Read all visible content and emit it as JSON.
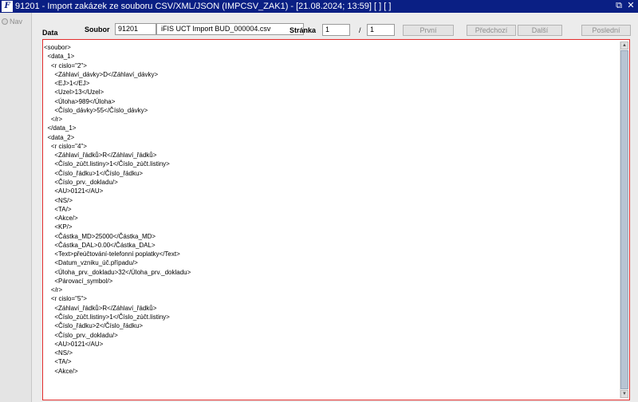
{
  "window": {
    "app_icon_text": "F",
    "title": "91201 - Import zakázek ze souboru CSV/XML/JSON (IMPCSV_ZAK1) - [21.08.2024; 13:59]  [ ]  [ ]",
    "restore_glyph": "⧉",
    "close_glyph": "✕"
  },
  "sidebar": {
    "nav_label": "Nav"
  },
  "toolbar": {
    "data_label": "Data",
    "soubor_label": "Soubor",
    "file_code": "91201",
    "file_name": "iFIS UCT Import BUD_000004.csv",
    "stranka_label": "Stránka",
    "page_current": "1",
    "page_separator": "/",
    "page_total": "1",
    "btn_first": "První",
    "btn_prev": "Předchozí",
    "btn_next": "Další",
    "btn_last": "Poslední"
  },
  "editor": {
    "lines": [
      "<soubor>",
      "  <data_1>",
      "    <r cislo=\"2\">",
      "      <Záhlaví_dávky>D</Záhlaví_dávky>",
      "      <EJ>1</EJ>",
      "      <Uzel>13</Uzel>",
      "      <Úloha>989</Úloha>",
      "      <Číslo_dávky>55</Číslo_dávky>",
      "    </r>",
      "  </data_1>",
      "  <data_2>",
      "    <r cislo=\"4\">",
      "      <Záhlaví_řádků>R</Záhlaví_řádků>",
      "      <Číslo_zúčt.listiny>1</Číslo_zúčt.listiny>",
      "      <Číslo_řádku>1</Číslo_řádku>",
      "      <Číslo_prv._dokladu/>",
      "      <AU>0121</AU>",
      "      <NS/>",
      "      <TA/>",
      "      <Akce/>",
      "      <KP/>",
      "      <Částka_MD>25000</Částka_MD>",
      "      <Částka_DAL>0.00</Částka_DAL>",
      "      <Text>přeúčtování-telefonní poplatky</Text>",
      "      <Datum_vzniku_úč.případu/>",
      "      <Úloha_prv._dokladu>32</Úloha_prv._dokladu>",
      "      <Párovací_symbol/>",
      "    </r>",
      "    <r cislo=\"5\">",
      "      <Záhlaví_řádků>R</Záhlaví_řádků>",
      "      <Číslo_zúčt.listiny>1</Číslo_zúčt.listiny>",
      "      <Číslo_řádku>2</Číslo_řádku>",
      "      <Číslo_prv._dokladu/>",
      "      <AU>0121</AU>",
      "      <NS/>",
      "      <TA/>",
      "      <Akce/>"
    ]
  },
  "scrollbar": {
    "up_glyph": "▲",
    "down_glyph": "▼",
    "position_fraction": 0
  },
  "colors": {
    "title_bar": "#0a1f84",
    "editor_border": "#e32d2d",
    "window_bg": "#ececec"
  }
}
